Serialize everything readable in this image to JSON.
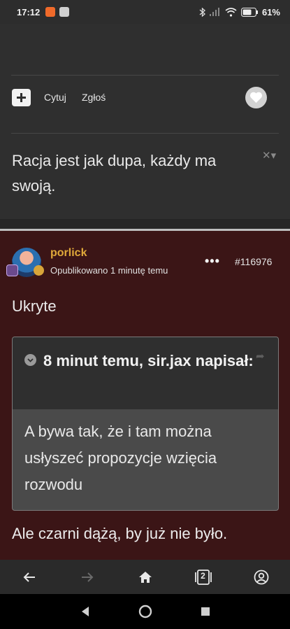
{
  "status_bar": {
    "time": "17:12",
    "battery": "61%"
  },
  "post1": {
    "actions": {
      "quote_label": "Cytuj",
      "report_label": "Zgłoś"
    },
    "text": "Racja jest jak dupa, każdy ma swoją."
  },
  "post2": {
    "author": "porlick",
    "published": "Opublikowano 1 minutę temu",
    "more": "•••",
    "id": "#116976",
    "hidden_label": "Ukryte",
    "quote": {
      "title": "8 minut temu, sir.jax napisał:",
      "body": "A bywa tak, że i tam można usłyszeć propozycje wzięcia rozwodu"
    },
    "reply": "Ale czarni dążą, by już nie było."
  },
  "browser_bar": {
    "tabs_count": "2"
  },
  "colors": {
    "author": "#e0a93a",
    "post2_bg": "#3b1516",
    "post1_bg": "#2f2f2f"
  },
  "icons": [
    "back-icon",
    "forward-icon",
    "home-icon",
    "tabs-icon",
    "account-icon",
    "heart-icon",
    "plus-icon",
    "share-icon",
    "chevron-down-icon"
  ]
}
